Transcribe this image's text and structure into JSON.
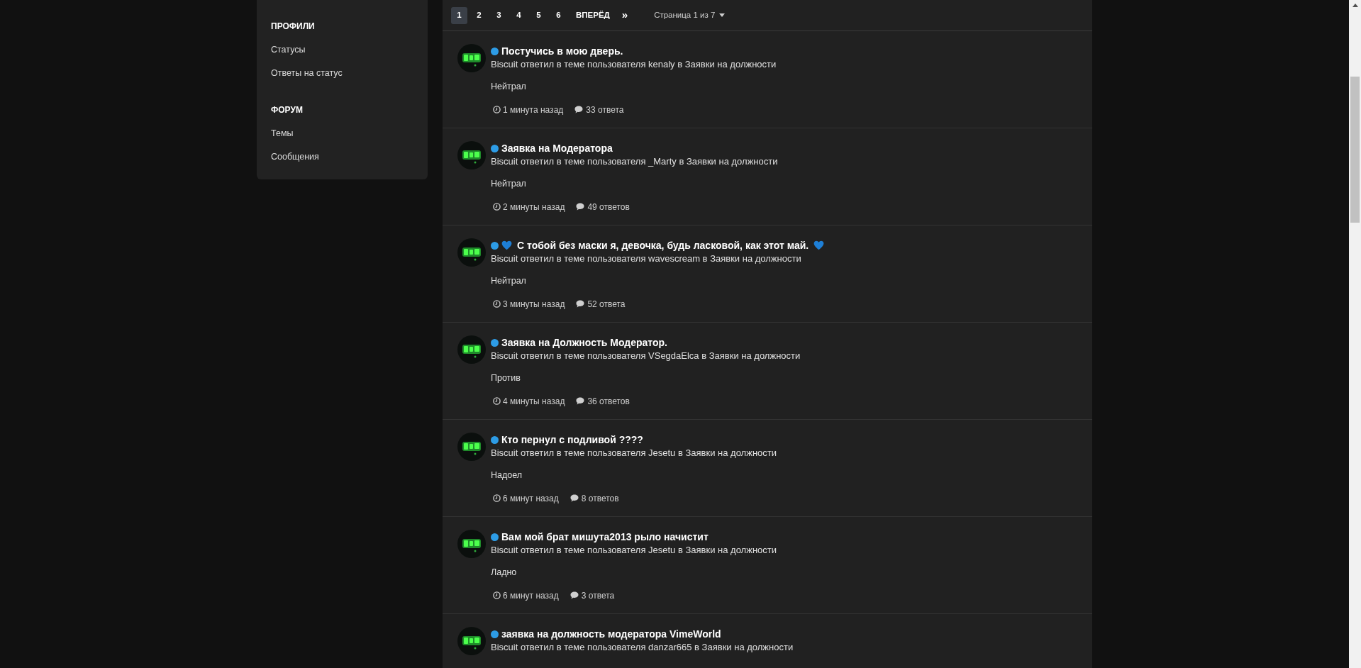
{
  "sidebar": {
    "sections": [
      {
        "heading": "ПРОФИЛИ",
        "items": [
          "Статусы",
          "Ответы на статус"
        ]
      },
      {
        "heading": "ФОРУМ",
        "items": [
          "Темы",
          "Сообщения"
        ]
      }
    ]
  },
  "pagination": {
    "pages": [
      {
        "label": "1",
        "selected": true
      },
      {
        "label": "2",
        "selected": false
      },
      {
        "label": "3",
        "selected": false
      },
      {
        "label": "4",
        "selected": false
      },
      {
        "label": "5",
        "selected": false
      },
      {
        "label": "6",
        "selected": false
      }
    ],
    "next": "ВПЕРЁД",
    "last": "»",
    "page_info": "Страница 1 из 7"
  },
  "activity": [
    {
      "title": "Постучись в мою дверь.",
      "hearts": false,
      "unread": true,
      "summary": "Biscuit ответил в теме пользователя kenaly в Заявки на должности",
      "text": "Нейтрал",
      "time": "1 минута назад",
      "replies": "33 ответа"
    },
    {
      "title": "Заявка на Модератора",
      "hearts": false,
      "unread": true,
      "summary": "Biscuit ответил в теме пользователя _Marty в Заявки на должности",
      "text": "Нейтрал",
      "time": "2 минуты назад",
      "replies": "49 ответов"
    },
    {
      "title": "С тобой без маски я, девочка, будь ласковой, как этот май.",
      "hearts": true,
      "unread": true,
      "summary": "Biscuit ответил в теме пользователя wavescream в Заявки на должности",
      "text": "Нейтрал",
      "time": "3 минуты назад",
      "replies": "52 ответа"
    },
    {
      "title": "Заявка на Должность Модератор.",
      "hearts": false,
      "unread": true,
      "summary": "Biscuit ответил в теме пользователя VSegdaElca в Заявки на должности",
      "text": "Против",
      "time": "4 минуты назад",
      "replies": "36 ответов"
    },
    {
      "title": "Кто пернул с подливой ????",
      "hearts": false,
      "unread": true,
      "summary": "Biscuit ответил в теме пользователя Jesetu в Заявки на должности",
      "text": "Надоел",
      "time": "6 минут назад",
      "replies": "8 ответов"
    },
    {
      "title": "Вам мой брат мишута2013 рыло начистит",
      "hearts": false,
      "unread": true,
      "summary": "Biscuit ответил в теме пользователя Jesetu в Заявки на должности",
      "text": "Ладно",
      "time": "6 минут назад",
      "replies": "3 ответа"
    },
    {
      "title": "заявка на должность модератора VimeWorld",
      "hearts": false,
      "unread": true,
      "summary": "Biscuit ответил в теме пользователя danzar665 в Заявки на должности"
    }
  ]
}
